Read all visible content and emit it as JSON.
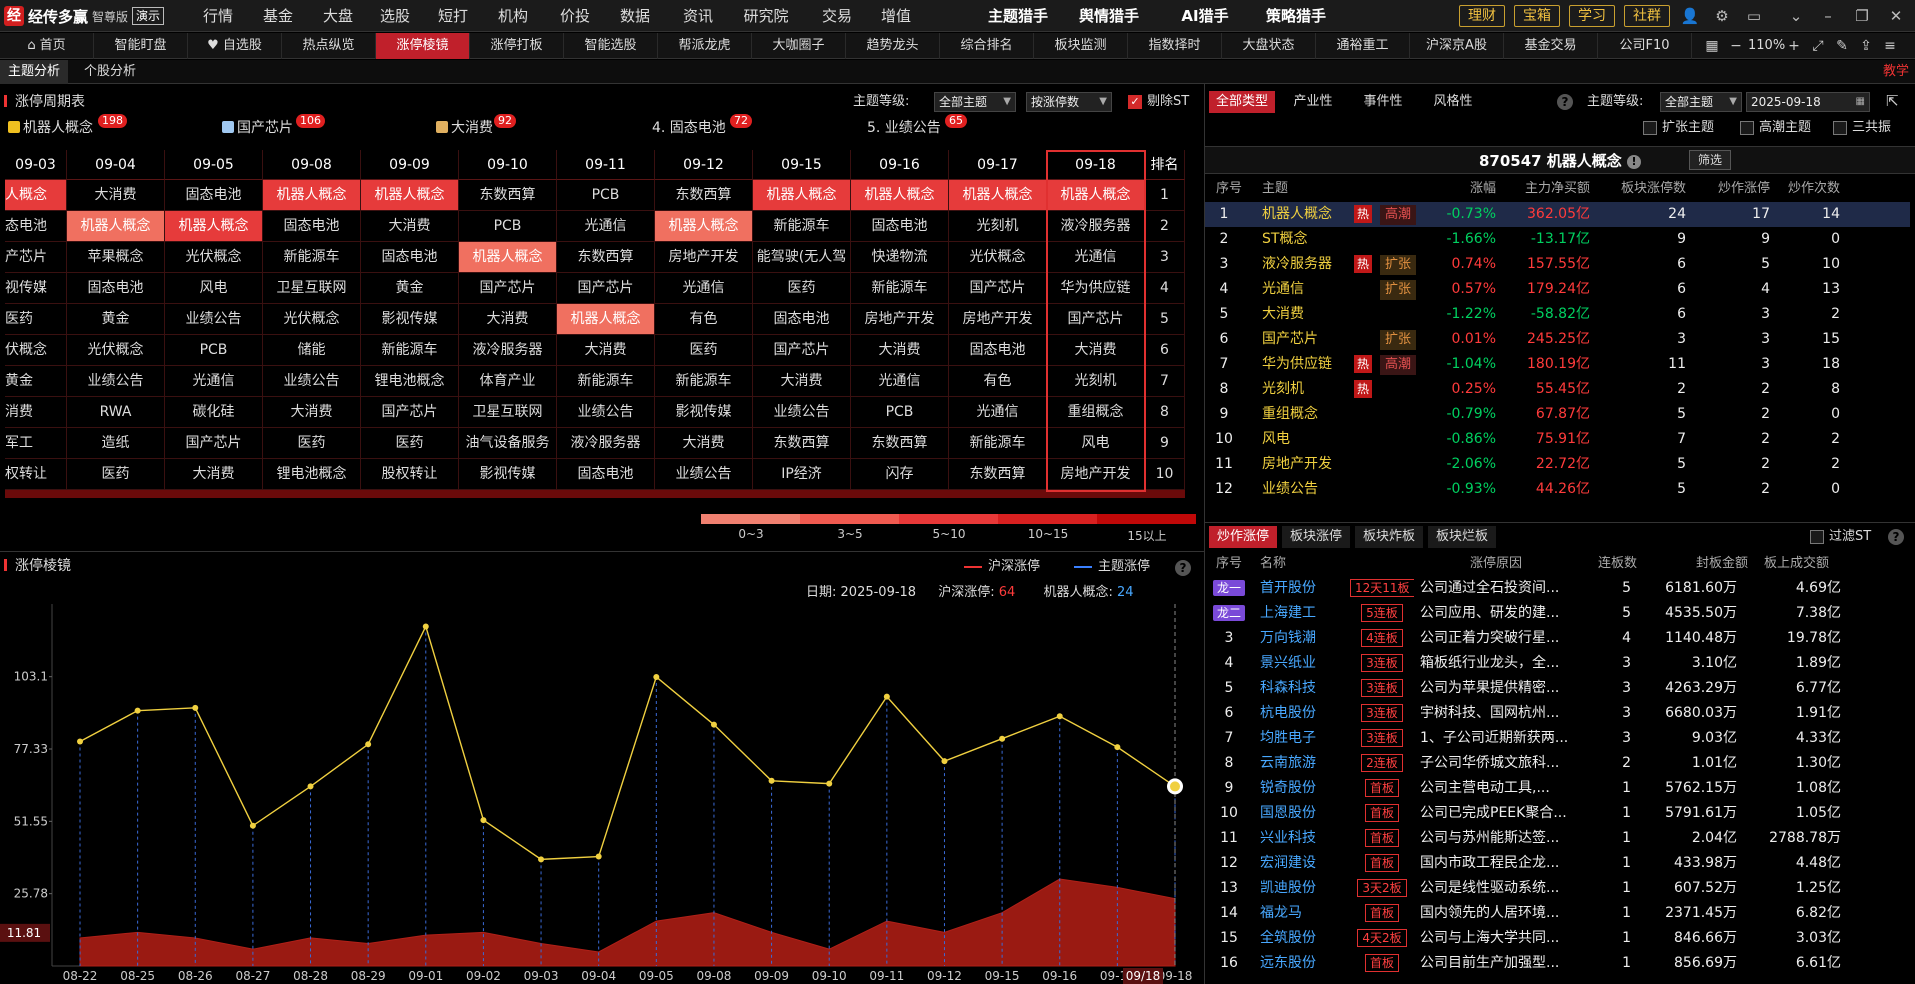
{
  "app": {
    "logo_char": "经",
    "name": "经传多赢",
    "edition": "智尊版",
    "demo": "演示"
  },
  "topnav": [
    "行情",
    "基金",
    "大盘",
    "选股",
    "短打",
    "机构",
    "价投",
    "数据",
    "资讯",
    "研究院",
    "交易",
    "增值"
  ],
  "topnav_bright": [
    "主题猎手",
    "舆情猎手",
    "AI猎手",
    "策略猎手"
  ],
  "top_buttons": [
    "理财",
    "宝箱",
    "学习",
    "社群"
  ],
  "tabs": [
    "首页",
    "智能盯盘",
    "自选股",
    "热点纵览",
    "涨停棱镜",
    "涨停打板",
    "智能选股",
    "帮派龙虎",
    "大咖圈子",
    "趋势龙头",
    "综合排名",
    "板块监测",
    "指数择时",
    "大盘状态",
    "通裕重工",
    "沪深京A股",
    "基金交易",
    "公司F10"
  ],
  "tab_icons": {
    "home": "home-icon",
    "fav": "heart-icon"
  },
  "zoom": "110%",
  "subtabs": [
    "主题分析",
    "个股分析"
  ],
  "teach": "教学",
  "left_panel": {
    "title": "涨停周期表",
    "level_label": "主题等级:",
    "level_value": "全部主题",
    "sort_value": "按涨停数",
    "exclude_st": "剔除ST",
    "top_themes": [
      {
        "label": "机器人概念",
        "badge": "198",
        "color": "#f0c020"
      },
      {
        "label": "国产芯片",
        "badge": "106",
        "color": "#a0c8f0"
      },
      {
        "label": "大消费",
        "badge": "92",
        "color": "#e0b060"
      },
      {
        "label": "4. 固态电池",
        "badge": "72",
        "color": ""
      },
      {
        "label": "5. 业绩公告",
        "badge": "65",
        "color": ""
      }
    ],
    "rank_header": "排名",
    "dates": [
      "09-03",
      "09-04",
      "09-05",
      "09-08",
      "09-09",
      "09-10",
      "09-11",
      "09-12",
      "09-15",
      "09-16",
      "09-17",
      "09-18"
    ],
    "grid": [
      [
        "人概念",
        "大消费",
        "固态电池",
        "机器人概念",
        "机器人概念",
        "东数西算",
        "PCB",
        "东数西算",
        "机器人概念",
        "机器人概念",
        "机器人概念",
        "机器人概念"
      ],
      [
        "态电池",
        "机器人概念",
        "机器人概念",
        "固态电池",
        "大消费",
        "PCB",
        "光通信",
        "机器人概念",
        "新能源车",
        "固态电池",
        "光刻机",
        "液冷服务器"
      ],
      [
        "产芯片",
        "苹果概念",
        "光伏概念",
        "新能源车",
        "固态电池",
        "机器人概念",
        "东数西算",
        "房地产开发",
        "能驾驶(无人驾",
        "快递物流",
        "光伏概念",
        "光通信"
      ],
      [
        "视传媒",
        "固态电池",
        "风电",
        "卫星互联网",
        "黄金",
        "国产芯片",
        "国产芯片",
        "光通信",
        "医药",
        "新能源车",
        "国产芯片",
        "华为供应链"
      ],
      [
        "医药",
        "黄金",
        "业绩公告",
        "光伏概念",
        "影视传媒",
        "大消费",
        "机器人概念",
        "有色",
        "固态电池",
        "房地产开发",
        "房地产开发",
        "国产芯片"
      ],
      [
        "伏概念",
        "光伏概念",
        "PCB",
        "储能",
        "新能源车",
        "液冷服务器",
        "大消费",
        "医药",
        "国产芯片",
        "大消费",
        "固态电池",
        "大消费"
      ],
      [
        "黄金",
        "业绩公告",
        "光通信",
        "业绩公告",
        "锂电池概念",
        "体育产业",
        "新能源车",
        "新能源车",
        "大消费",
        "光通信",
        "有色",
        "光刻机"
      ],
      [
        "消费",
        "RWA",
        "碳化硅",
        "大消费",
        "国产芯片",
        "卫星互联网",
        "业绩公告",
        "影视传媒",
        "业绩公告",
        "PCB",
        "光通信",
        "重组概念"
      ],
      [
        "军工",
        "造纸",
        "国产芯片",
        "医药",
        "医药",
        "油气设备服务",
        "液冷服务器",
        "大消费",
        "东数西算",
        "东数西算",
        "新能源车",
        "风电"
      ],
      [
        "权转让",
        "医药",
        "大消费",
        "锂电池概念",
        "股权转让",
        "影视传媒",
        "固态电池",
        "业绩公告",
        "IP经济",
        "闪存",
        "东数西算",
        "房地产开发"
      ]
    ],
    "highlight": [
      [
        1,
        0,
        0,
        1,
        1,
        0,
        0,
        0,
        1,
        1,
        1,
        1
      ],
      [
        0,
        2,
        1,
        0,
        0,
        0,
        0,
        2,
        0,
        0,
        0,
        0
      ],
      [
        0,
        0,
        0,
        0,
        0,
        2,
        0,
        0,
        0,
        0,
        0,
        0
      ],
      [
        0,
        0,
        0,
        0,
        0,
        0,
        0,
        0,
        0,
        0,
        0,
        0
      ],
      [
        0,
        0,
        0,
        0,
        0,
        0,
        2,
        0,
        0,
        0,
        0,
        0
      ],
      [
        0,
        0,
        0,
        0,
        0,
        0,
        0,
        0,
        0,
        0,
        0,
        0
      ],
      [
        0,
        0,
        0,
        0,
        0,
        0,
        0,
        0,
        0,
        0,
        0,
        0
      ],
      [
        0,
        0,
        0,
        0,
        0,
        0,
        0,
        0,
        0,
        0,
        0,
        0
      ],
      [
        0,
        0,
        0,
        0,
        0,
        0,
        0,
        0,
        0,
        0,
        0,
        0
      ],
      [
        0,
        0,
        0,
        0,
        0,
        0,
        0,
        0,
        0,
        0,
        0,
        0
      ]
    ],
    "ranks": [
      "1",
      "2",
      "3",
      "4",
      "5",
      "6",
      "7",
      "8",
      "9",
      "10"
    ],
    "legend": [
      {
        "label": "0~3",
        "color": "#f08070"
      },
      {
        "label": "3~5",
        "color": "#f05a50"
      },
      {
        "label": "5~10",
        "color": "#e83838"
      },
      {
        "label": "10~15",
        "color": "#d82020"
      },
      {
        "label": "15以上",
        "color": "#c00808"
      }
    ]
  },
  "bottom_panel": {
    "title": "涨停棱镜",
    "legend_market": "沪深涨停",
    "legend_theme": "主题涨停",
    "info_date_label": "日期:",
    "info_date": "2025-09-18",
    "info_market_label": "沪深涨停:",
    "info_market_value": "64",
    "info_theme_label": "机器人概念:",
    "info_theme_value": "24",
    "crosshair_x_label": "09/18",
    "crosshair_y_label": "11.81"
  },
  "chart_data": {
    "type": "line",
    "title": "",
    "x": [
      "08-22",
      "08-25",
      "08-26",
      "08-27",
      "08-28",
      "08-29",
      "09-01",
      "09-02",
      "09-03",
      "09-04",
      "09-05",
      "09-08",
      "09-09",
      "09-10",
      "09-11",
      "09-12",
      "09-15",
      "09-16",
      "09-17",
      "09-18"
    ],
    "yticks": [
      25.78,
      51.55,
      77.33,
      103.1
    ],
    "ylim": [
      0,
      129
    ],
    "series": [
      {
        "name": "沪深涨停",
        "color": "#f0d040",
        "type": "line",
        "values": [
          80,
          91,
          92,
          50,
          64,
          79,
          121,
          52,
          38,
          39,
          103,
          86,
          66,
          65,
          96,
          73,
          81,
          89,
          78,
          64
        ]
      },
      {
        "name": "主题涨停",
        "color": "#9a1a12",
        "type": "area",
        "values": [
          10,
          12,
          10,
          6,
          10,
          8,
          11,
          12,
          8,
          5,
          16,
          19,
          12,
          6,
          16,
          12,
          19,
          31,
          28,
          24
        ]
      }
    ]
  },
  "right_panel": {
    "tabs": [
      "全部类型",
      "产业性",
      "事件性",
      "风格性"
    ],
    "level_label": "主题等级:",
    "level_value": "全部主题",
    "date_value": "2025-09-18",
    "options": [
      "扩张主题",
      "高潮主题",
      "三共振"
    ],
    "title": "870547 机器人概念",
    "filter_btn": "筛选",
    "columns": [
      "序号",
      "主题",
      "涨幅",
      "主力净买额",
      "板块涨停数",
      "炒作涨停",
      "炒作次数"
    ],
    "rows": [
      {
        "idx": "1",
        "name": "机器人概念",
        "hot": "热",
        "stage": "高潮",
        "pct": "-0.73%",
        "net": "362.05亿",
        "lim": "24",
        "hype": "17",
        "times": "14"
      },
      {
        "idx": "2",
        "name": "ST概念",
        "hot": "",
        "stage": "",
        "pct": "-1.66%",
        "net": "-13.17亿",
        "lim": "9",
        "hype": "9",
        "times": "0"
      },
      {
        "idx": "3",
        "name": "液冷服务器",
        "hot": "热",
        "stage": "扩张",
        "pct": "0.74%",
        "net": "157.55亿",
        "lim": "6",
        "hype": "5",
        "times": "10"
      },
      {
        "idx": "4",
        "name": "光通信",
        "hot": "",
        "stage": "扩张",
        "pct": "0.57%",
        "net": "179.24亿",
        "lim": "6",
        "hype": "4",
        "times": "13"
      },
      {
        "idx": "5",
        "name": "大消费",
        "hot": "",
        "stage": "",
        "pct": "-1.22%",
        "net": "-58.82亿",
        "lim": "6",
        "hype": "3",
        "times": "2"
      },
      {
        "idx": "6",
        "name": "国产芯片",
        "hot": "",
        "stage": "扩张",
        "pct": "0.01%",
        "net": "245.25亿",
        "lim": "3",
        "hype": "3",
        "times": "15"
      },
      {
        "idx": "7",
        "name": "华为供应链",
        "hot": "热",
        "stage": "高潮",
        "pct": "-1.04%",
        "net": "180.19亿",
        "lim": "11",
        "hype": "3",
        "times": "18"
      },
      {
        "idx": "8",
        "name": "光刻机",
        "hot": "热",
        "stage": "",
        "pct": "0.25%",
        "net": "55.45亿",
        "lim": "2",
        "hype": "2",
        "times": "8"
      },
      {
        "idx": "9",
        "name": "重组概念",
        "hot": "",
        "stage": "",
        "pct": "-0.79%",
        "net": "67.87亿",
        "lim": "5",
        "hype": "2",
        "times": "0"
      },
      {
        "idx": "10",
        "name": "风电",
        "hot": "",
        "stage": "",
        "pct": "-0.86%",
        "net": "75.91亿",
        "lim": "7",
        "hype": "2",
        "times": "2"
      },
      {
        "idx": "11",
        "name": "房地产开发",
        "hot": "",
        "stage": "",
        "pct": "-2.06%",
        "net": "22.72亿",
        "lim": "5",
        "hype": "2",
        "times": "2"
      },
      {
        "idx": "12",
        "name": "业绩公告",
        "hot": "",
        "stage": "",
        "pct": "-0.93%",
        "net": "44.26亿",
        "lim": "5",
        "hype": "2",
        "times": "0"
      }
    ],
    "stock_tabs": [
      "炒作涨停",
      "板块涨停",
      "板块炸板",
      "板块烂板"
    ],
    "filter_st": "过滤ST",
    "stock_columns": [
      "序号",
      "名称",
      "涨停原因",
      "连板数",
      "封板金额",
      "板上成交额"
    ],
    "stocks": [
      {
        "idx": "龙一",
        "name": "首开股份",
        "tag": "12天11板",
        "reason": "公司通过全石投资间...",
        "lb": "5",
        "amt": "6181.60万",
        "turn": "4.69亿"
      },
      {
        "idx": "龙二",
        "name": "上海建工",
        "tag": "5连板",
        "reason": "公司应用、研发的建...",
        "lb": "5",
        "amt": "4535.50万",
        "turn": "7.38亿"
      },
      {
        "idx": "3",
        "name": "万向钱潮",
        "tag": "4连板",
        "reason": "公司正着力突破行星...",
        "lb": "4",
        "amt": "1140.48万",
        "turn": "19.78亿"
      },
      {
        "idx": "4",
        "name": "景兴纸业",
        "tag": "3连板",
        "reason": "箱板纸行业龙头，全...",
        "lb": "3",
        "amt": "3.10亿",
        "turn": "1.89亿"
      },
      {
        "idx": "5",
        "name": "科森科技",
        "tag": "3连板",
        "reason": "公司为苹果提供精密...",
        "lb": "3",
        "amt": "4263.29万",
        "turn": "6.77亿"
      },
      {
        "idx": "6",
        "name": "杭电股份",
        "tag": "3连板",
        "reason": "宇树科技、国网杭州...",
        "lb": "3",
        "amt": "6680.03万",
        "turn": "1.91亿"
      },
      {
        "idx": "7",
        "name": "均胜电子",
        "tag": "3连板",
        "reason": "1、子公司近期新获两...",
        "lb": "3",
        "amt": "9.03亿",
        "turn": "4.33亿"
      },
      {
        "idx": "8",
        "name": "云南旅游",
        "tag": "2连板",
        "reason": "子公司华侨城文旅科...",
        "lb": "2",
        "amt": "1.01亿",
        "turn": "1.30亿"
      },
      {
        "idx": "9",
        "name": "锐奇股份",
        "tag": "首板",
        "reason": "公司主营电动工具,...",
        "lb": "1",
        "amt": "5762.15万",
        "turn": "1.08亿"
      },
      {
        "idx": "10",
        "name": "国恩股份",
        "tag": "首板",
        "reason": "公司已完成PEEK聚合...",
        "lb": "1",
        "amt": "5791.61万",
        "turn": "1.05亿"
      },
      {
        "idx": "11",
        "name": "兴业科技",
        "tag": "首板",
        "reason": "公司与苏州能斯达签...",
        "lb": "1",
        "amt": "2.04亿",
        "turn": "2788.78万"
      },
      {
        "idx": "12",
        "name": "宏润建设",
        "tag": "首板",
        "reason": "国内市政工程民企龙...",
        "lb": "1",
        "amt": "433.98万",
        "turn": "4.48亿"
      },
      {
        "idx": "13",
        "name": "凯迪股份",
        "tag": "3天2板",
        "reason": "公司是线性驱动系统...",
        "lb": "1",
        "amt": "607.52万",
        "turn": "1.25亿"
      },
      {
        "idx": "14",
        "name": "福龙马",
        "tag": "首板",
        "reason": "国内领先的人居环境...",
        "lb": "1",
        "amt": "2371.45万",
        "turn": "6.82亿"
      },
      {
        "idx": "15",
        "name": "全筑股份",
        "tag": "4天2板",
        "reason": "公司与上海大学共同...",
        "lb": "1",
        "amt": "846.66万",
        "turn": "3.03亿"
      },
      {
        "idx": "16",
        "name": "远东股份",
        "tag": "首板",
        "reason": "公司目前生产加强型...",
        "lb": "1",
        "amt": "856.69万",
        "turn": "6.61亿"
      }
    ]
  }
}
